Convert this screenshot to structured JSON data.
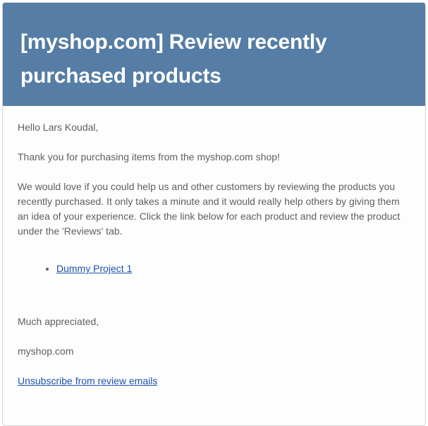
{
  "email": {
    "title": "[myshop.com] Review recently purchased products",
    "greeting": "Hello Lars Koudal,",
    "thanks": "Thank you for purchasing items from the myshop.com shop!",
    "request": "We would love if you could help us and other customers by reviewing the products you recently purchased. It only takes a minute and it would really help others by giving them an idea of your experience. Click the link below for each product and review the product under the 'Reviews' tab.",
    "products": [
      {
        "label": "Dummy Project 1"
      }
    ],
    "signoff": "Much appreciated,",
    "sender": "myshop.com",
    "unsubscribe_label": "Unsubscribe from review emails"
  },
  "colors": {
    "header_bg": "#557da5",
    "link": "#1c53ad",
    "body_text": "#5f5f5f"
  }
}
